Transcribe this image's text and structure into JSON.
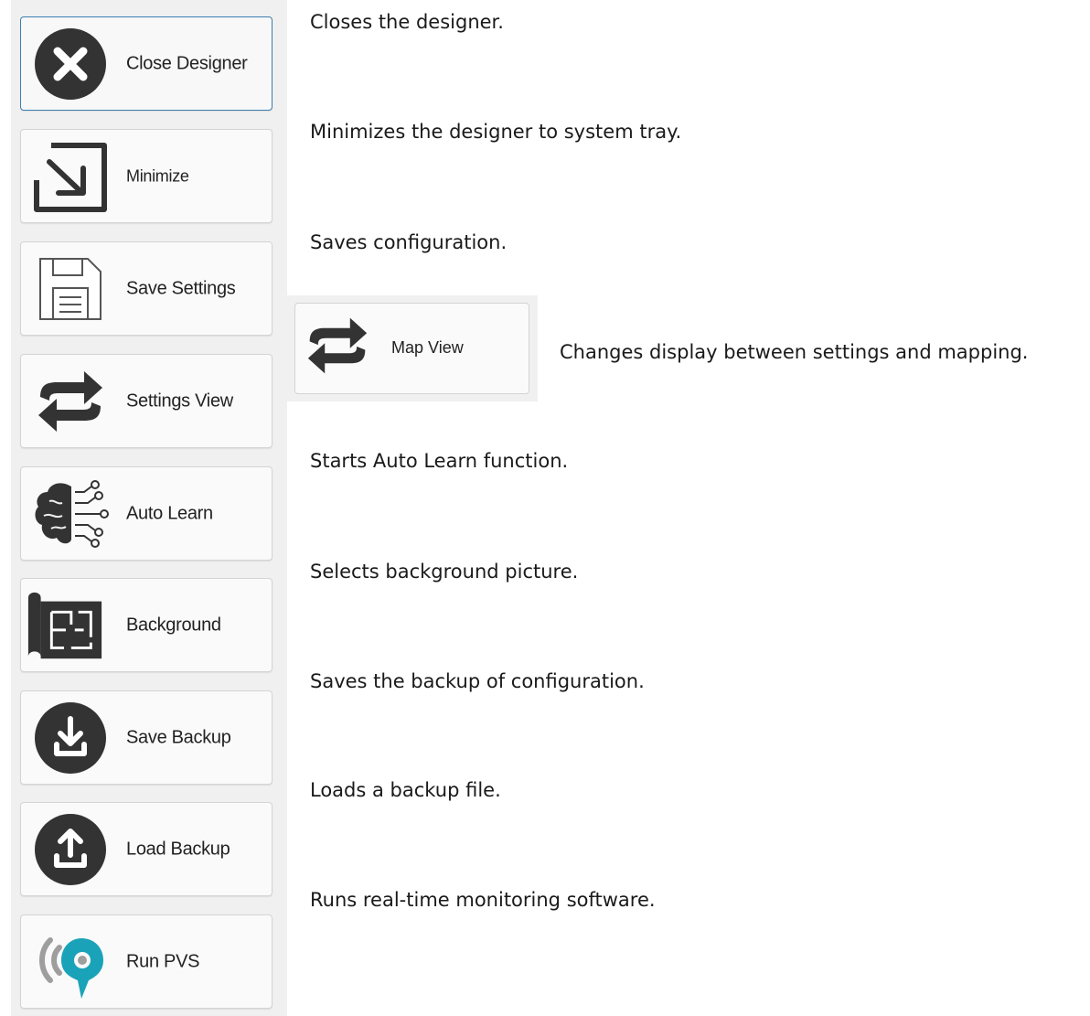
{
  "buttons": [
    {
      "label": "Close Designer",
      "icon": "close-icon"
    },
    {
      "label": "Minimize",
      "icon": "minimize-arrow-icon"
    },
    {
      "label": "Save Settings",
      "icon": "floppy-disk-icon"
    },
    {
      "label": "Settings View",
      "icon": "swap-arrows-icon"
    },
    {
      "label": "Auto Learn",
      "icon": "brain-circuit-icon"
    },
    {
      "label": "Background",
      "icon": "floor-plan-icon"
    },
    {
      "label": "Save Backup",
      "icon": "download-icon"
    },
    {
      "label": "Load Backup",
      "icon": "upload-icon"
    },
    {
      "label": "Run PVS",
      "icon": "pvs-signal-icon"
    }
  ],
  "map_button": {
    "label": "Map View",
    "icon": "swap-arrows-icon"
  },
  "descriptions": [
    "Closes the designer.",
    "Minimizes the designer to system tray.",
    "Saves configuration.",
    "Changes display between settings and mapping.",
    "Starts Auto Learn function.",
    "Selects background picture.",
    "Saves the backup of configuration.",
    "Loads a backup file.",
    "Runs real-time monitoring software."
  ],
  "colors": {
    "icon_dark": "#333333",
    "pvs_teal": "#1aa3b8",
    "pvs_grey": "#9e9e9e",
    "active_border": "#3c7fb1"
  }
}
